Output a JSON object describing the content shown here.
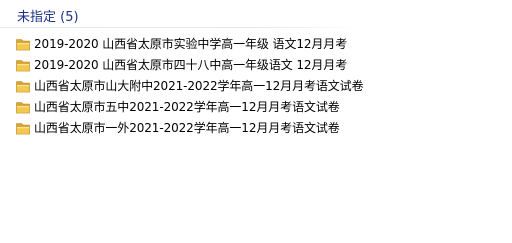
{
  "group": {
    "title": "未指定 (5)"
  },
  "files": [
    {
      "name": "2019-2020 山西省太原市实验中学高一年级 语文12月月考",
      "icon": "folder-icon"
    },
    {
      "name": "2019-2020 山西省太原市四十八中高一年级语文 12月月考",
      "icon": "folder-icon"
    },
    {
      "name": "山西省太原市山大附中2021-2022学年高一12月月考语文试卷",
      "icon": "folder-icon"
    },
    {
      "name": "山西省太原市五中2021-2022学年高一12月月考语文试卷",
      "icon": "folder-icon"
    },
    {
      "name": "山西省太原市一外2021-2022学年高一12月月考语文试卷",
      "icon": "folder-icon"
    }
  ],
  "colors": {
    "group_title": "#1e3287",
    "folder_body": "#f0c24f",
    "folder_back": "#d9a532"
  }
}
